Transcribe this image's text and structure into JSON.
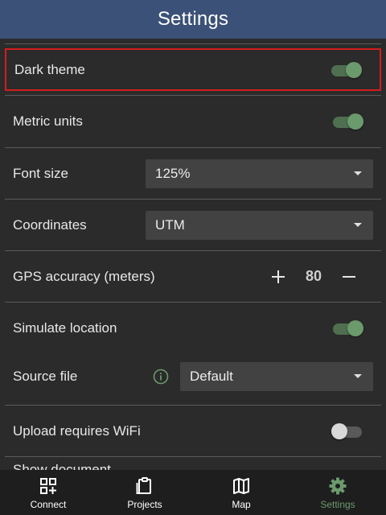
{
  "header": {
    "title": "Settings"
  },
  "settings": {
    "dark_theme": {
      "label": "Dark theme",
      "enabled": true
    },
    "metric_units": {
      "label": "Metric units",
      "enabled": true
    },
    "font_size": {
      "label": "Font size",
      "value": "125%"
    },
    "coordinates": {
      "label": "Coordinates",
      "value": "UTM"
    },
    "gps_accuracy": {
      "label": "GPS accuracy (meters)",
      "value": "80",
      "increment": "+",
      "decrement": "−"
    },
    "simulate_location": {
      "label": "Simulate location",
      "enabled": true
    },
    "source_file": {
      "label": "Source file",
      "value": "Default"
    },
    "upload_wifi": {
      "label": "Upload requires WiFi",
      "enabled": false
    },
    "partial_next": {
      "label": "Show document"
    }
  },
  "nav": {
    "tabs": [
      {
        "label": "Connect",
        "icon": "qr-add-icon",
        "active": false
      },
      {
        "label": "Projects",
        "icon": "clipboard-icon",
        "active": false
      },
      {
        "label": "Map",
        "icon": "map-icon",
        "active": false
      },
      {
        "label": "Settings",
        "icon": "gear-icon",
        "active": true
      }
    ]
  },
  "colors": {
    "appbar": "#3b5177",
    "background": "#2b2b2b",
    "accent_green": "#6b9a6d",
    "highlight_red": "#d31d1d",
    "nav_background": "#1e1e1e"
  }
}
